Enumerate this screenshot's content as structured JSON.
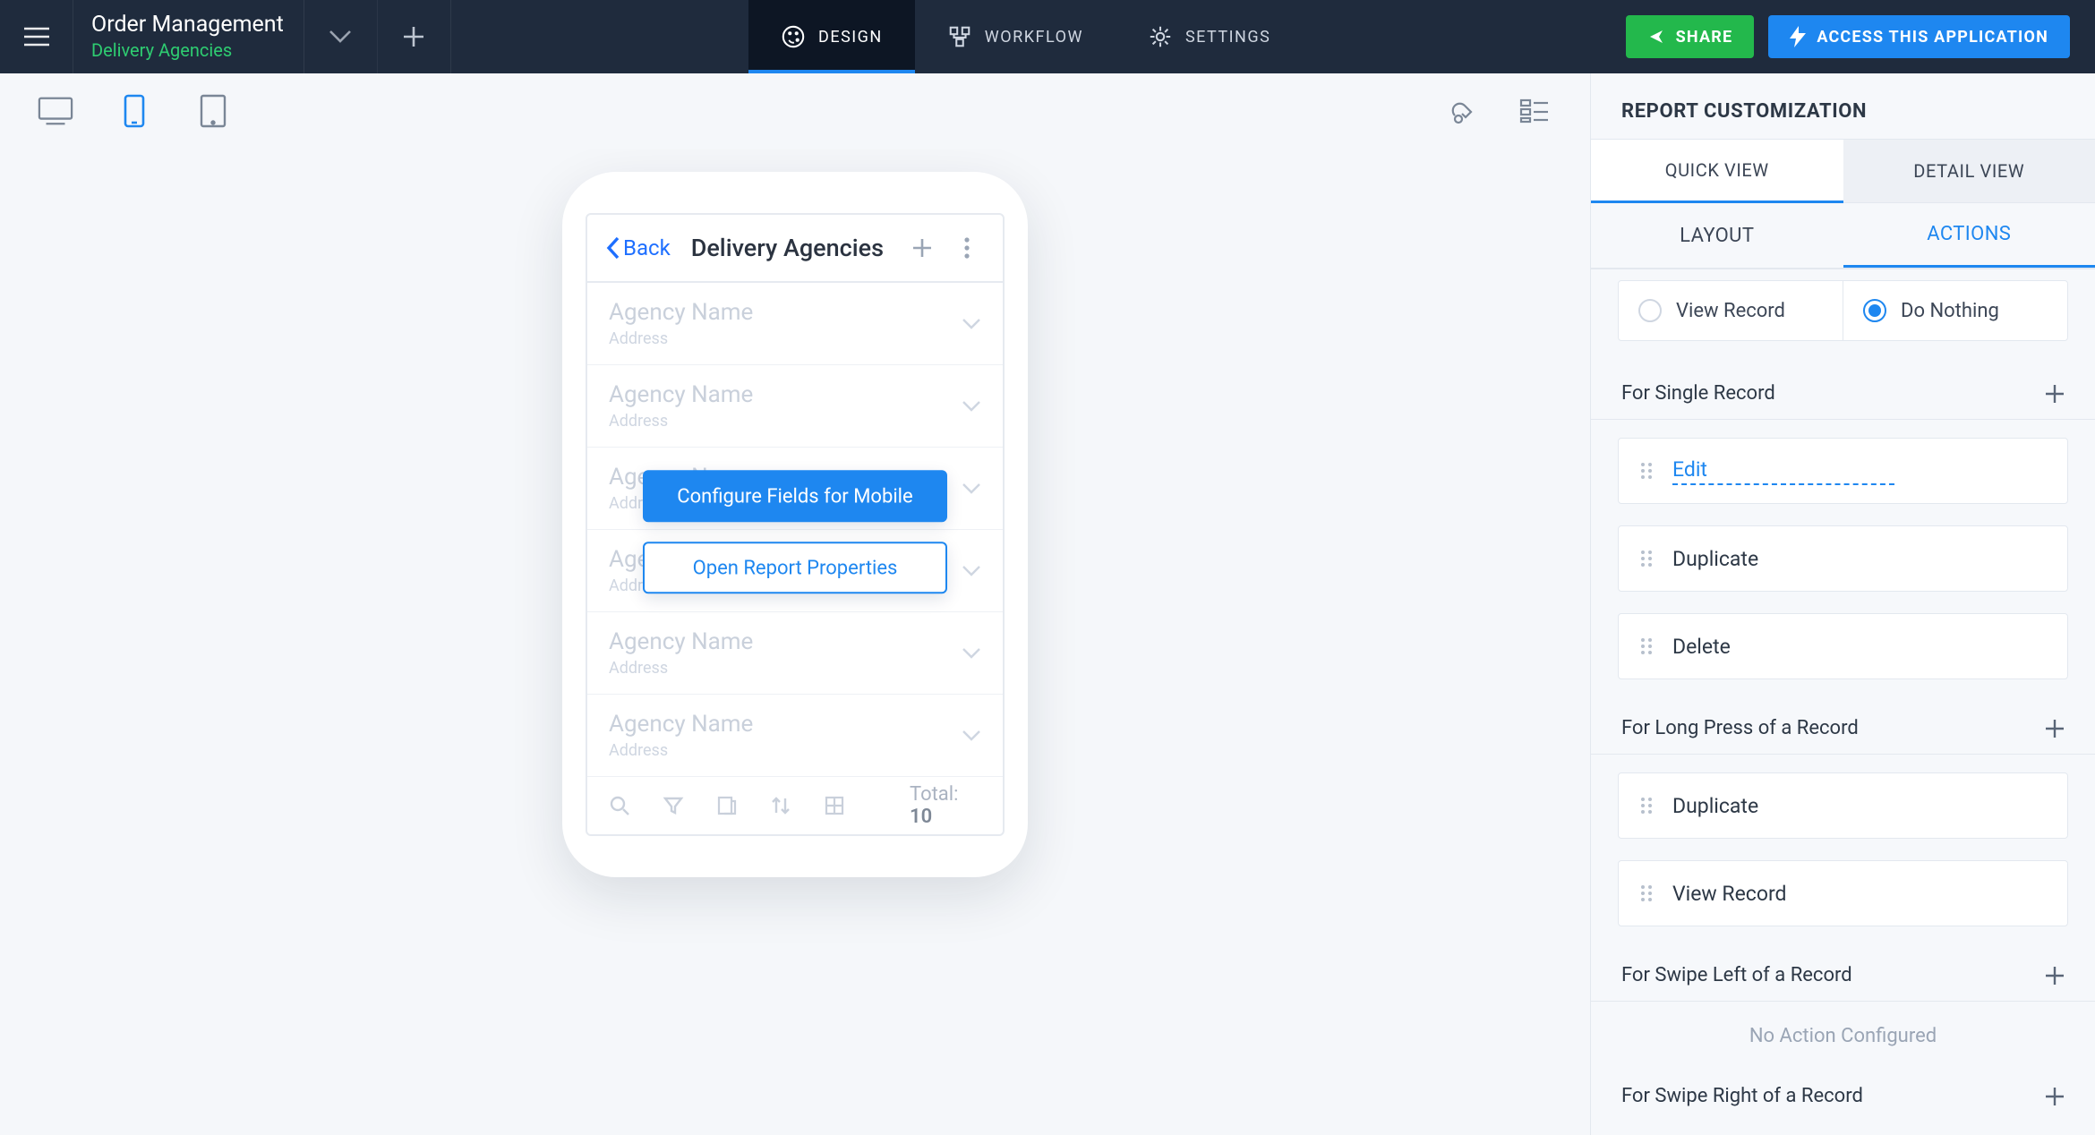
{
  "header": {
    "app_title": "Order Management",
    "subtitle": "Delivery Agencies",
    "tabs": {
      "design": "DESIGN",
      "workflow": "WORKFLOW",
      "settings": "SETTINGS"
    },
    "buttons": {
      "share": "SHARE",
      "access": "ACCESS  THIS  APPLICATION"
    }
  },
  "mock": {
    "back_label": "Back",
    "title": "Delivery Agencies",
    "row_title": "Agency Name",
    "row_subtitle": "Address",
    "total_label": "Total:",
    "total_value": "10",
    "overlay": {
      "configure": "Configure Fields for Mobile",
      "open_props": "Open Report Properties"
    }
  },
  "panel": {
    "title": "REPORT CUSTOMIZATION",
    "view_tabs": {
      "quick": "QUICK VIEW",
      "detail": "DETAIL VIEW"
    },
    "sub_tabs": {
      "layout": "LAYOUT",
      "actions": "ACTIONS"
    },
    "radio": {
      "view_record": "View Record",
      "do_nothing": "Do Nothing"
    },
    "groups": {
      "single": "For Single Record",
      "long_press": "For Long Press of a Record",
      "swipe_left": "For Swipe Left of a Record",
      "swipe_right": "For Swipe Right of a Record"
    },
    "actions": {
      "edit": "Edit",
      "duplicate": "Duplicate",
      "delete": "Delete",
      "view_record": "View Record"
    },
    "empty": "No Action Configured"
  }
}
